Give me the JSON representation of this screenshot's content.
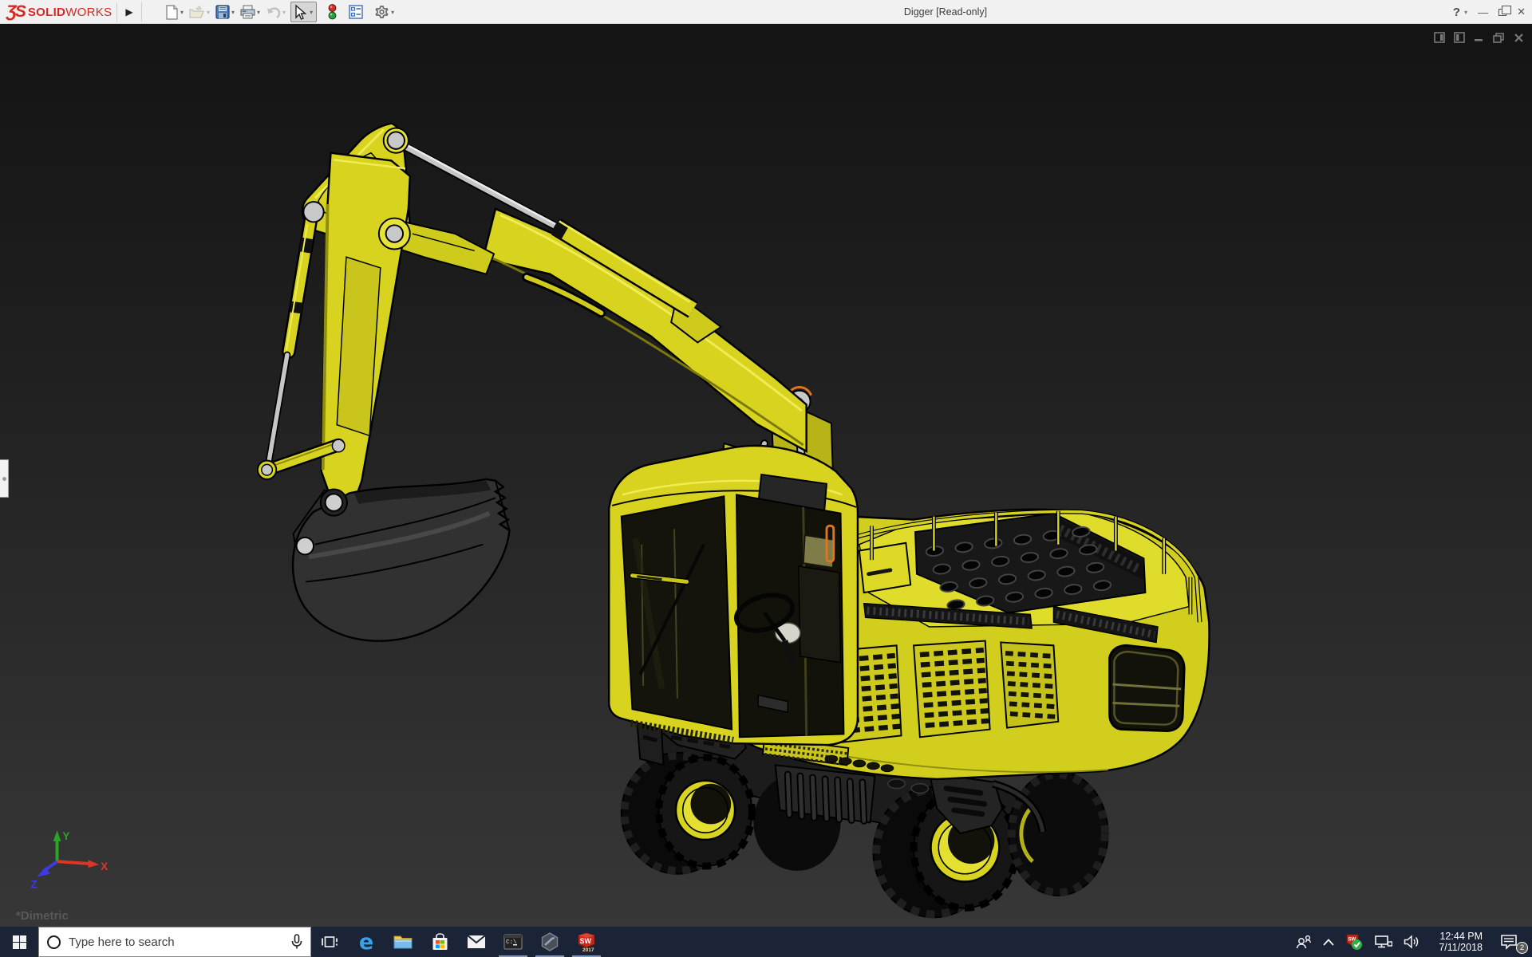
{
  "titlebar": {
    "logo": {
      "symbol": "ƷS",
      "brand_bold": "SOLID",
      "brand_light": "WORKS",
      "flyout_arrow": "▶"
    },
    "title": "Digger [Read-only]",
    "help_label": "?",
    "caret": "▾",
    "buttons": {
      "minimize": "—",
      "close": "✕"
    }
  },
  "toolbar": {
    "caret": "▾",
    "items": [
      {
        "name": "new-document",
        "enabled": true,
        "dropdown": true
      },
      {
        "name": "open",
        "enabled": false,
        "dropdown": true
      },
      {
        "name": "save",
        "enabled": true,
        "dropdown": true
      },
      {
        "name": "print",
        "enabled": true,
        "dropdown": true
      },
      {
        "name": "undo",
        "enabled": false,
        "dropdown": true
      },
      {
        "name": "select",
        "enabled": true,
        "active": true,
        "dropdown": true
      },
      {
        "name": "rebuild-traffic-light",
        "enabled": true,
        "dropdown": false
      },
      {
        "name": "options-list",
        "enabled": true,
        "dropdown": false
      },
      {
        "name": "settings-gear",
        "enabled": true,
        "dropdown": true
      }
    ]
  },
  "viewport": {
    "view_orientation": "*Dimetric",
    "background_top": "#141414",
    "background_bottom": "#373737",
    "triad": {
      "x_label": "X",
      "y_label": "Y",
      "z_label": "Z",
      "x_color": "#e03424",
      "y_color": "#2aa52a",
      "z_color": "#3b3be0"
    }
  },
  "model": {
    "subject": "Digger wheeled excavator 3D model",
    "body_yellow": "#d7d31f",
    "shade_yellow": "#a5a214",
    "highlight_yellow": "#f0ec55",
    "glass": "#14140c",
    "tires": "#111111",
    "metal_gray": "#c6c6c6",
    "accent_orange": "#e0761c"
  },
  "taskbar": {
    "background": "#1b2336",
    "search_placeholder": "Type here to search",
    "edge_letter": "e",
    "cmd_label": "C:\\",
    "sw_label": "SW",
    "sw_year": "2017",
    "sw_tray_label": "SW",
    "clock_time": "12:44 PM",
    "clock_date": "7/11/2018",
    "notification_count": "2",
    "apps": [
      "task-view",
      "edge",
      "file-explorer",
      "store",
      "mail",
      "command-prompt",
      "cad-hexagon",
      "solidworks-2017"
    ],
    "running_apps": [
      "command-prompt",
      "cad-hexagon",
      "solidworks-2017"
    ]
  }
}
